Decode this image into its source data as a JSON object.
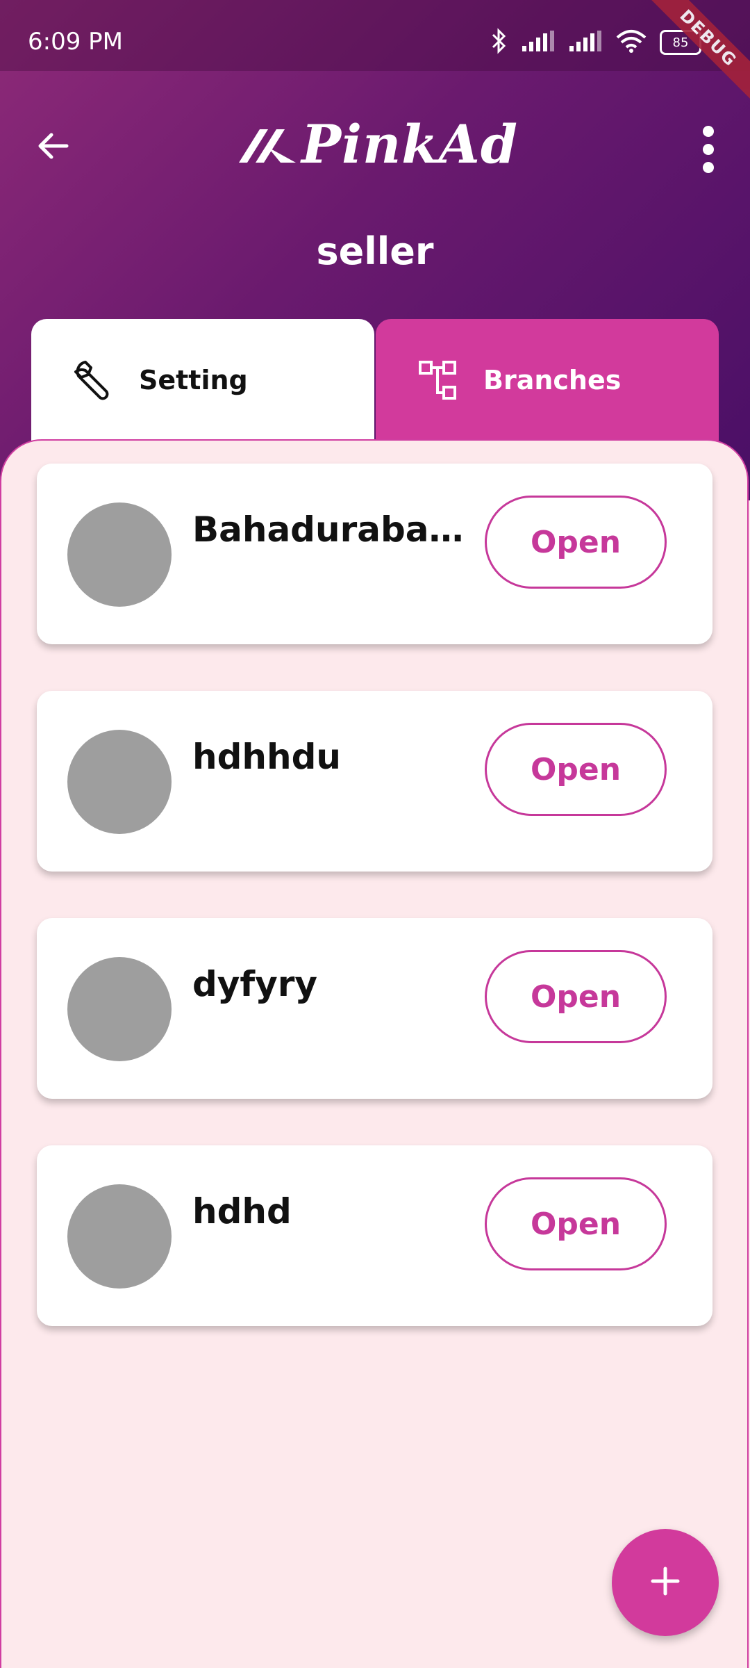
{
  "status_bar": {
    "time": "6:09 PM",
    "battery": "85",
    "icons": [
      "bluetooth-icon",
      "signal-icon",
      "signal-icon",
      "wifi-icon",
      "battery-icon"
    ]
  },
  "debug_banner": "DEBUG",
  "app_bar": {
    "logo_text": "PinkAd",
    "back_icon": "arrow-left-icon",
    "menu_icon": "more-vertical-icon"
  },
  "page_title": "seller",
  "tabs": [
    {
      "label": "Setting",
      "icon": "wrench-icon",
      "active": false
    },
    {
      "label": "Branches",
      "icon": "hierarchy-icon",
      "active": true
    }
  ],
  "branches": [
    {
      "name": "Bahadurabad Branch",
      "action": "Open"
    },
    {
      "name": "hdhhdu",
      "action": "Open"
    },
    {
      "name": "dyfyry",
      "action": "Open"
    },
    {
      "name": "hdhd",
      "action": "Open"
    }
  ],
  "fab_icon": "plus-icon",
  "colors": {
    "accent": "#d23a9c",
    "header_start": "#8e2a78",
    "header_end": "#4a0f66",
    "background": "#fde9ec",
    "avatar": "#9e9e9e"
  }
}
